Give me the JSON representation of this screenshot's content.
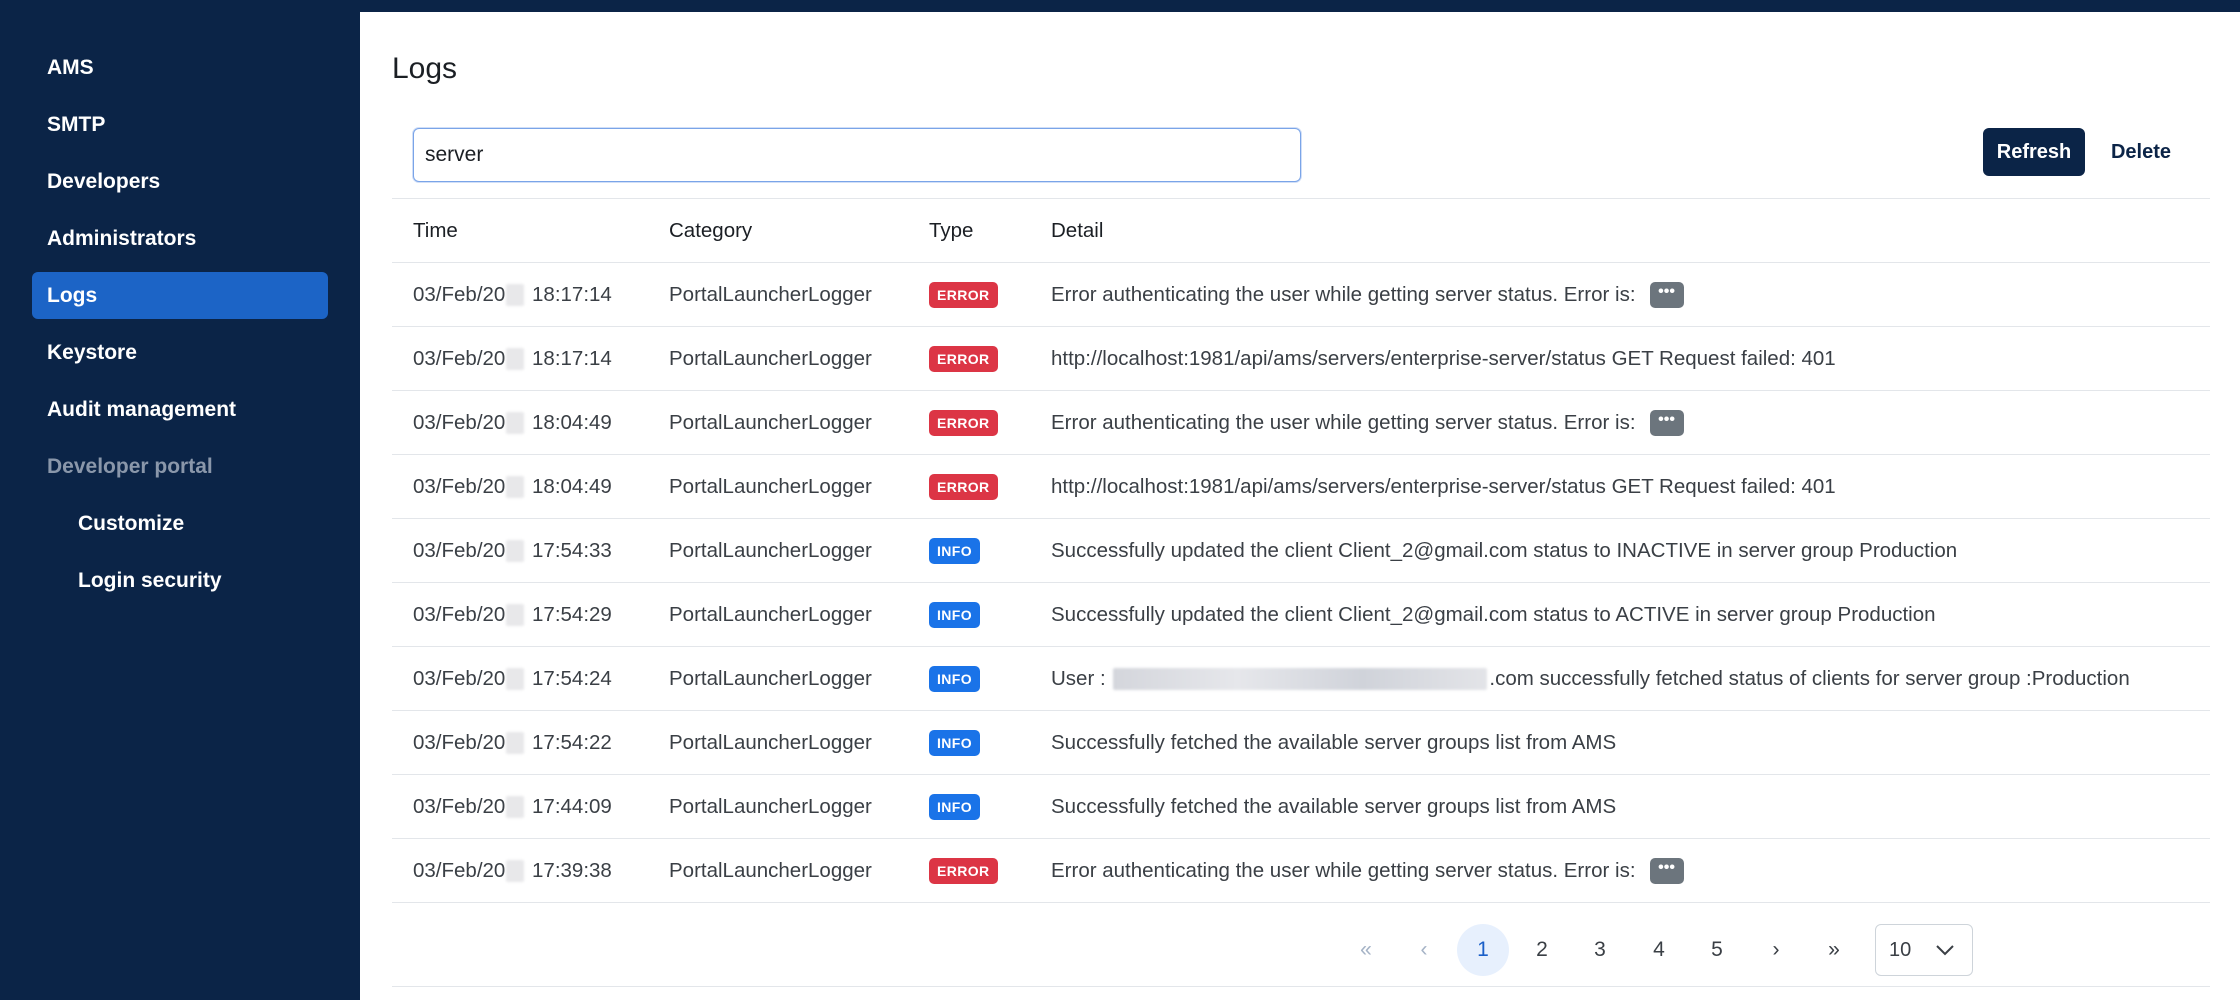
{
  "sidebar": {
    "items": [
      {
        "label": "AMS"
      },
      {
        "label": "SMTP"
      },
      {
        "label": "Developers"
      },
      {
        "label": "Administrators"
      },
      {
        "label": "Logs"
      },
      {
        "label": "Keystore"
      },
      {
        "label": "Audit management"
      },
      {
        "label": "Developer portal"
      },
      {
        "label": "Customize"
      },
      {
        "label": "Login security"
      }
    ],
    "active": "Logs"
  },
  "page": {
    "title": "Logs"
  },
  "search": {
    "value": "server"
  },
  "toolbar": {
    "refresh_label": "Refresh",
    "delete_label": "Delete"
  },
  "table": {
    "headers": {
      "time": "Time",
      "category": "Category",
      "type": "Type",
      "detail": "Detail"
    },
    "rows": [
      {
        "date_prefix": "03/Feb/20",
        "time": "18:17:14",
        "category": "PortalLauncherLogger",
        "type": "ERROR",
        "detail": "Error authenticating the user while getting server status. Error is:",
        "more": "•••"
      },
      {
        "date_prefix": "03/Feb/20",
        "time": "18:17:14",
        "category": "PortalLauncherLogger",
        "type": "ERROR",
        "detail": "http://localhost:1981/api/ams/servers/enterprise-server/status GET Request failed: 401"
      },
      {
        "date_prefix": "03/Feb/20",
        "time": "18:04:49",
        "category": "PortalLauncherLogger",
        "type": "ERROR",
        "detail": "Error authenticating the user while getting server status. Error is:",
        "more": "•••"
      },
      {
        "date_prefix": "03/Feb/20",
        "time": "18:04:49",
        "category": "PortalLauncherLogger",
        "type": "ERROR",
        "detail": "http://localhost:1981/api/ams/servers/enterprise-server/status GET Request failed: 401"
      },
      {
        "date_prefix": "03/Feb/20",
        "time": "17:54:33",
        "category": "PortalLauncherLogger",
        "type": "INFO",
        "detail": "Successfully updated the client Client_2@gmail.com status to INACTIVE in server group Production"
      },
      {
        "date_prefix": "03/Feb/20",
        "time": "17:54:29",
        "category": "PortalLauncherLogger",
        "type": "INFO",
        "detail": "Successfully updated the client Client_2@gmail.com status to ACTIVE in server group Production"
      },
      {
        "date_prefix": "03/Feb/20",
        "time": "17:54:24",
        "category": "PortalLauncherLogger",
        "type": "INFO",
        "detail_prefix": "User :",
        "detail": ".com successfully fetched status of clients for server group :Production"
      },
      {
        "date_prefix": "03/Feb/20",
        "time": "17:54:22",
        "category": "PortalLauncherLogger",
        "type": "INFO",
        "detail": "Successfully fetched the available server groups list from AMS"
      },
      {
        "date_prefix": "03/Feb/20",
        "time": "17:44:09",
        "category": "PortalLauncherLogger",
        "type": "INFO",
        "detail": "Successfully fetched the available server groups list from AMS"
      },
      {
        "date_prefix": "03/Feb/20",
        "time": "17:39:38",
        "category": "PortalLauncherLogger",
        "type": "ERROR",
        "detail": "Error authenticating the user while getting server status. Error is:",
        "more": "•••"
      }
    ]
  },
  "pagination": {
    "first": "«",
    "prev": "‹",
    "next": "›",
    "last": "»",
    "pages": [
      "1",
      "2",
      "3",
      "4",
      "5"
    ],
    "current": "1",
    "page_size": "10"
  },
  "colors": {
    "sidebar_bg": "#0b2447",
    "active_nav": "#1c64c6",
    "error_badge": "#dc3545",
    "info_badge": "#1a73e8"
  }
}
